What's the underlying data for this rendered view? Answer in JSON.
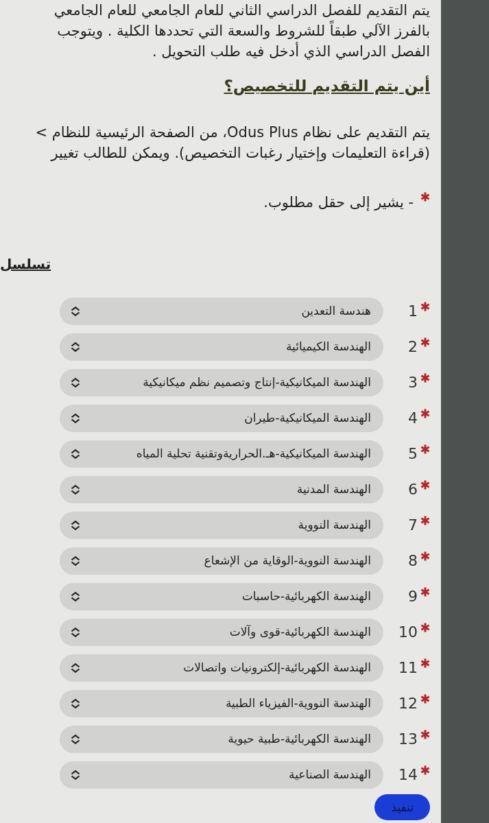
{
  "intro": {
    "lines": [
      "يتم التقديم للفصل الدراسي الثاني للعام الجامعي للعام الجامعي",
      "بالفرز الآلي طبقاً للشروط والسعة التي تحددها الكلية . ويتوجب",
      "الفصل الدراسي الذي أدخل فيه طلب التحويل ."
    ]
  },
  "section_heading": "أين يتم التقديم للتخصيص؟",
  "instructions": {
    "lines": [
      "يتم التقديم على نظام Odus Plus، من الصفحة الرئيسية للنظام >",
      "(قراءة التعليمات وإختيار رغبات التخصيص). ويمكن للطالب تغيير"
    ]
  },
  "required_note": "- يشير إلى حقل مطلوب.",
  "list_heading": "تسلسل",
  "preferences": [
    {
      "number": "1",
      "required": true,
      "value": "هندسة التعدين"
    },
    {
      "number": "2",
      "required": true,
      "value": "الهندسة الكيميائية"
    },
    {
      "number": "3",
      "required": true,
      "value": "الهندسة الميكانيكية-إنتاج وتصميم نظم ميكانيكية"
    },
    {
      "number": "4",
      "required": true,
      "value": "الهندسة الميكانيكية-طيران"
    },
    {
      "number": "5",
      "required": true,
      "value": "الهندسة الميكانيكية-هـ.الحراريةوتقنية تحلية المياه"
    },
    {
      "number": "6",
      "required": true,
      "value": "الهندسة المدنية"
    },
    {
      "number": "7",
      "required": true,
      "value": "الهندسة النووية"
    },
    {
      "number": "8",
      "required": true,
      "value": "الهندسة النووية-الوقاية من الإشعاع"
    },
    {
      "number": "9",
      "required": true,
      "value": "الهندسة الكهربائية-حاسبات"
    },
    {
      "number": "10",
      "required": true,
      "value": "الهندسة الكهربائية-قوى وآلات"
    },
    {
      "number": "11",
      "required": true,
      "value": "الهندسة الكهربائية-إلكترونيات واتصالات"
    },
    {
      "number": "12",
      "required": true,
      "value": "الهندسة النووية-الفيزياء الطبية"
    },
    {
      "number": "13",
      "required": true,
      "value": "الهندسة الكهربائية-طبية حيوية"
    },
    {
      "number": "14",
      "required": true,
      "value": "الهندسة الصناعية"
    }
  ],
  "submit_button": "تنفيذ"
}
